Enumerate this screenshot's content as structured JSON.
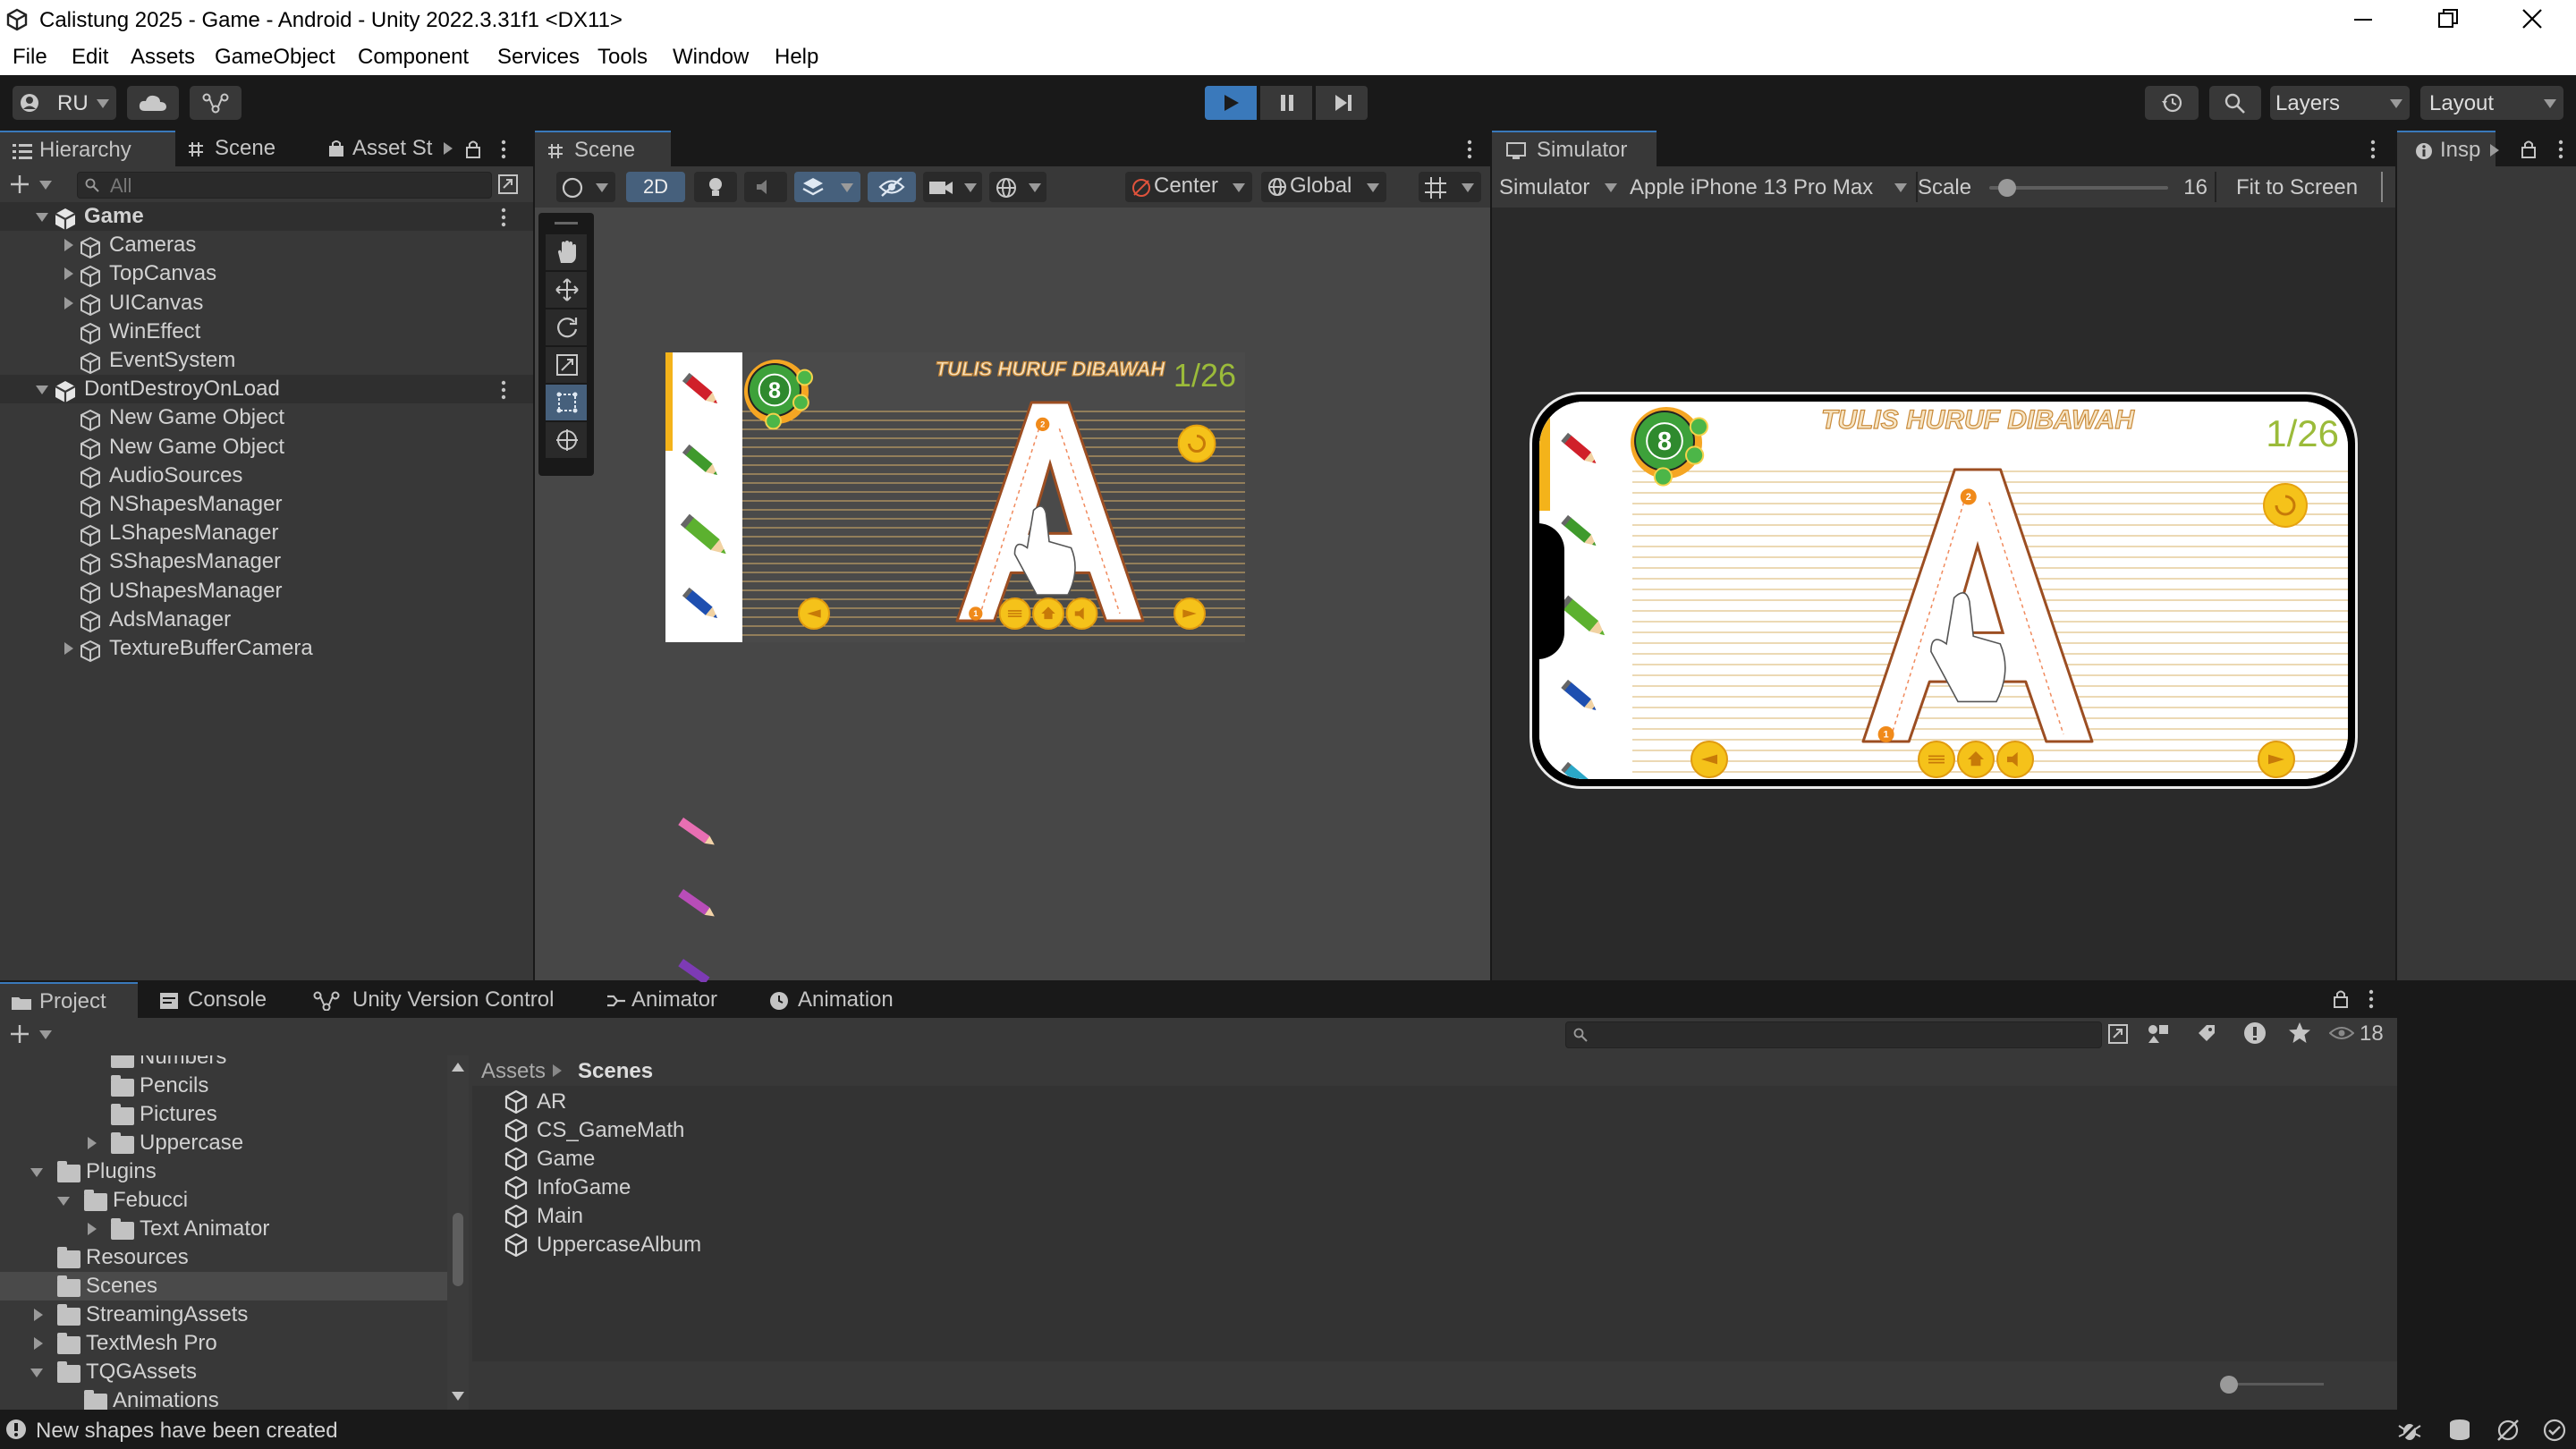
{
  "window": {
    "title": "Calistung 2025 - Game - Android - Unity 2022.3.31f1 <DX11>"
  },
  "menu": [
    "File",
    "Edit",
    "Assets",
    "GameObject",
    "Component",
    "Services",
    "Tools",
    "Window",
    "Help"
  ],
  "toolbar": {
    "account": "RU",
    "layers": "Layers",
    "layout": "Layout"
  },
  "hierarchy": {
    "tabs": [
      "Hierarchy",
      "Scene",
      "Asset St"
    ],
    "search_placeholder": "All",
    "items": [
      {
        "label": "Game",
        "level": 0,
        "scene": true,
        "expanded": true
      },
      {
        "label": "Cameras",
        "level": 1,
        "children": true
      },
      {
        "label": "TopCanvas",
        "level": 1,
        "children": true
      },
      {
        "label": "UICanvas",
        "level": 1,
        "children": true
      },
      {
        "label": "WinEffect",
        "level": 1,
        "children": false
      },
      {
        "label": "EventSystem",
        "level": 1,
        "children": false
      },
      {
        "label": "DontDestroyOnLoad",
        "level": 0,
        "scene": true,
        "expanded": true
      },
      {
        "label": "New Game Object",
        "level": 1,
        "children": false
      },
      {
        "label": "New Game Object",
        "level": 1,
        "children": false
      },
      {
        "label": "AudioSources",
        "level": 1,
        "children": false
      },
      {
        "label": "NShapesManager",
        "level": 1,
        "children": false
      },
      {
        "label": "LShapesManager",
        "level": 1,
        "children": false
      },
      {
        "label": "SShapesManager",
        "level": 1,
        "children": false
      },
      {
        "label": "UShapesManager",
        "level": 1,
        "children": false
      },
      {
        "label": "AdsManager",
        "level": 1,
        "children": false
      },
      {
        "label": "TextureBufferCamera",
        "level": 1,
        "children": true
      }
    ]
  },
  "scene": {
    "tab": "Scene",
    "toggle_2d": "2D",
    "pivot": "Center",
    "space": "Global",
    "game": {
      "heading": "TULIS HURUF DIBAWAH",
      "counter": "1/26",
      "letter": "A",
      "score": "8",
      "step_1": "1",
      "step_2": "2"
    }
  },
  "simulator": {
    "tab": "Simulator",
    "mode": "Simulator",
    "device": "Apple iPhone 13 Pro Max",
    "scale_label": "Scale",
    "scale_value": "16",
    "scale_fraction": 0.1,
    "fit": "Fit to Screen",
    "game": {
      "heading": "TULIS HURUF DIBAWAH",
      "counter": "1/26",
      "letter": "A",
      "score": "8",
      "step_1": "1",
      "step_2": "2"
    }
  },
  "inspector": {
    "tab": "Insp"
  },
  "bottom": {
    "tabs": [
      "Project",
      "Console",
      "Unity Version Control",
      "Animator",
      "Animation"
    ],
    "hidden_count": "18",
    "breadcrumb": [
      "Assets",
      "Scenes"
    ],
    "tree": [
      {
        "label": "Numbers",
        "level": 2,
        "arrow": false,
        "partial": true
      },
      {
        "label": "Pencils",
        "level": 2,
        "arrow": false
      },
      {
        "label": "Pictures",
        "level": 2,
        "arrow": false
      },
      {
        "label": "Uppercase",
        "level": 2,
        "arrow": "right"
      },
      {
        "label": "Plugins",
        "level": 0,
        "arrow": "down"
      },
      {
        "label": "Febucci",
        "level": 1,
        "arrow": "down"
      },
      {
        "label": "Text Animator",
        "level": 2,
        "arrow": "right"
      },
      {
        "label": "Resources",
        "level": 0,
        "arrow": false
      },
      {
        "label": "Scenes",
        "level": 0,
        "arrow": false,
        "selected": true
      },
      {
        "label": "StreamingAssets",
        "level": 0,
        "arrow": "right"
      },
      {
        "label": "TextMesh Pro",
        "level": 0,
        "arrow": "right"
      },
      {
        "label": "TQGAssets",
        "level": 0,
        "arrow": "down"
      },
      {
        "label": "Animations",
        "level": 1,
        "arrow": false
      }
    ],
    "files": [
      "AR",
      "CS_GameMath",
      "Game",
      "InfoGame",
      "Main",
      "UppercaseAlbum"
    ]
  },
  "status": {
    "message": "New shapes have been created"
  },
  "colors": {
    "accent": "#3a79bb",
    "panel": "#383838",
    "dark": "#191919",
    "play_active": "#3a79bb"
  }
}
